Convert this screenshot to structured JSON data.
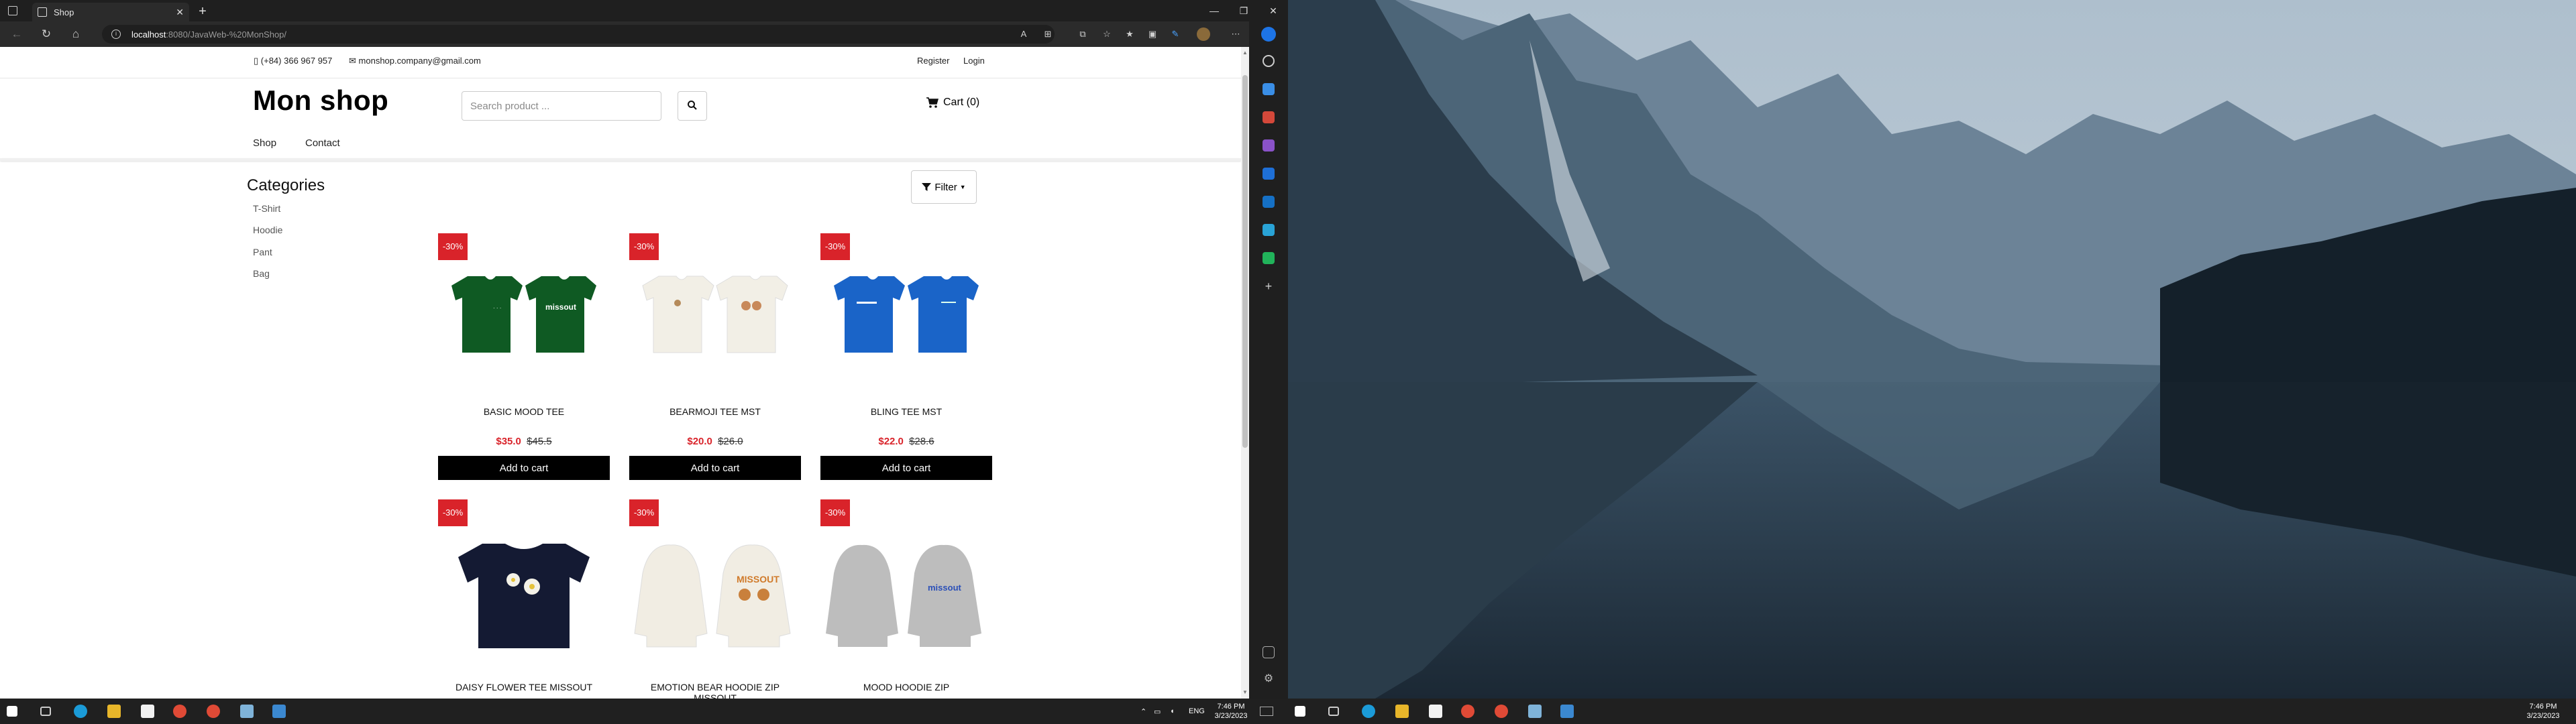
{
  "browser": {
    "tab_title": "Shop",
    "url_host": "localhost",
    "url_path": ":8080/JavaWeb-%20MonShop/"
  },
  "topbar": {
    "phone": "(+84) 366 967 957",
    "email": "monshop.company@gmail.com",
    "register": "Register",
    "login": "Login"
  },
  "header": {
    "brand": "Mon shop",
    "search_placeholder": "Search product ...",
    "cart": "Cart (0)"
  },
  "menu": {
    "shop": "Shop",
    "contact": "Contact"
  },
  "categories": {
    "title": "Categories",
    "items": [
      "T-Shirt",
      "Hoodie",
      "Pant",
      "Bag"
    ]
  },
  "filter": {
    "label": "Filter"
  },
  "products": [
    {
      "badge": "-30%",
      "name": "BASIC MOOD TEE",
      "price": "$35.0",
      "old_price": "$45.5",
      "button": "Add to cart",
      "color": "#0f5a23"
    },
    {
      "badge": "-30%",
      "name": "BEARMOJI TEE MST",
      "price": "$20.0",
      "old_price": "$26.0",
      "button": "Add to cart",
      "color": "#f2efe6"
    },
    {
      "badge": "-30%",
      "name": "BLING TEE MST",
      "price": "$22.0",
      "old_price": "$28.6",
      "button": "Add to cart",
      "color": "#1a64c8"
    },
    {
      "badge": "-30%",
      "name": "DAISY FLOWER TEE MISSOUT",
      "color": "#141a33"
    },
    {
      "badge": "-30%",
      "name": "EMOTION BEAR HOODIE ZIP MISSOUT",
      "color": "#f1ede3"
    },
    {
      "badge": "-30%",
      "name": "MOOD HOODIE ZIP",
      "color": "#bdbdbd"
    }
  ],
  "taskbar": {
    "lang": "ENG",
    "time": "7:46 PM",
    "date": "3/23/2023"
  },
  "taskbar_right": {
    "time": "7:46 PM",
    "date": "3/23/2023"
  }
}
